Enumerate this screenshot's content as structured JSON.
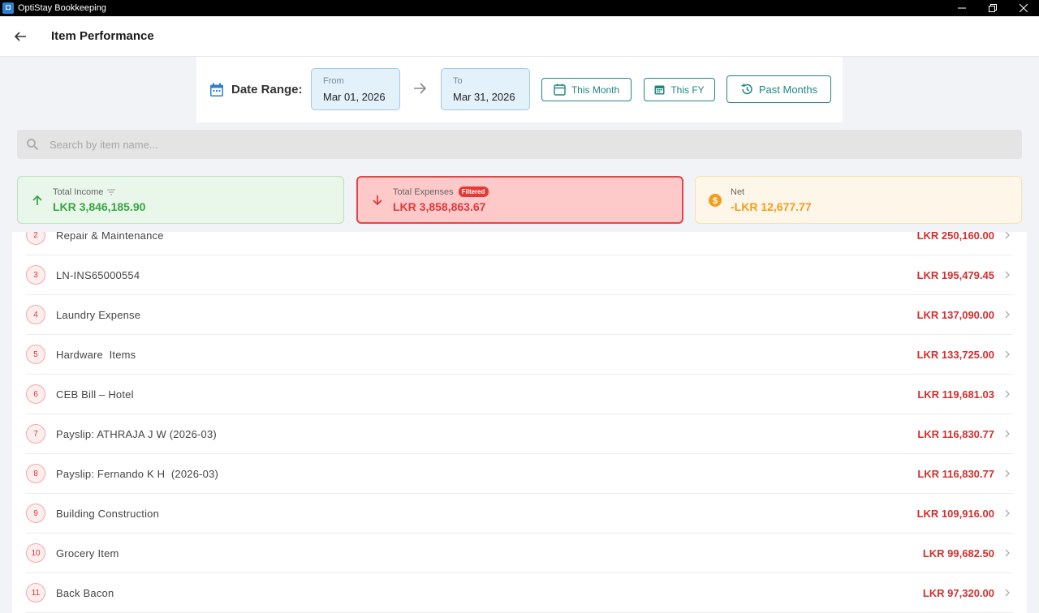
{
  "window": {
    "title": "OptiStay Bookkeeping"
  },
  "header": {
    "title": "Item Performance"
  },
  "date_range": {
    "label": "Date Range:",
    "from_label": "From",
    "from_value": "Mar 01, 2026",
    "to_label": "To",
    "to_value": "Mar 31, 2026",
    "this_month": "This Month",
    "this_fy": "This FY",
    "past_months": "Past Months"
  },
  "search": {
    "placeholder": "Search by item name..."
  },
  "summary": {
    "income": {
      "label": "Total Income",
      "value": "LKR 3,846,185.90"
    },
    "expenses": {
      "label": "Total Expenses",
      "badge": "Filtered",
      "value": "LKR 3,858,863.67"
    },
    "net": {
      "label": "Net",
      "value": "-LKR 12,677.77"
    }
  },
  "items": [
    {
      "rank": "2",
      "name": "Repair & Maintenance",
      "amount": "LKR 250,160.00"
    },
    {
      "rank": "3",
      "name": "LN-INS65000554",
      "amount": "LKR 195,479.45"
    },
    {
      "rank": "4",
      "name": "Laundry Expense",
      "amount": "LKR 137,090.00"
    },
    {
      "rank": "5",
      "name": "Hardware  Items",
      "amount": "LKR 133,725.00"
    },
    {
      "rank": "6",
      "name": "CEB Bill – Hotel",
      "amount": "LKR 119,681.03"
    },
    {
      "rank": "7",
      "name": "Payslip: ATHRAJA J W (2026-03)",
      "amount": "LKR 116,830.77"
    },
    {
      "rank": "8",
      "name": "Payslip: Fernando K H  (2026-03)",
      "amount": "LKR 116,830.77"
    },
    {
      "rank": "9",
      "name": "Building Construction",
      "amount": "LKR 109,916.00"
    },
    {
      "rank": "10",
      "name": "Grocery Item",
      "amount": "LKR 99,682.50"
    },
    {
      "rank": "11",
      "name": "Back Bacon",
      "amount": "LKR 97,320.00"
    }
  ],
  "colors": {
    "accent": "#20877d",
    "income": "#3aa545",
    "expense": "#e0393e",
    "net": "#f29d1c"
  }
}
